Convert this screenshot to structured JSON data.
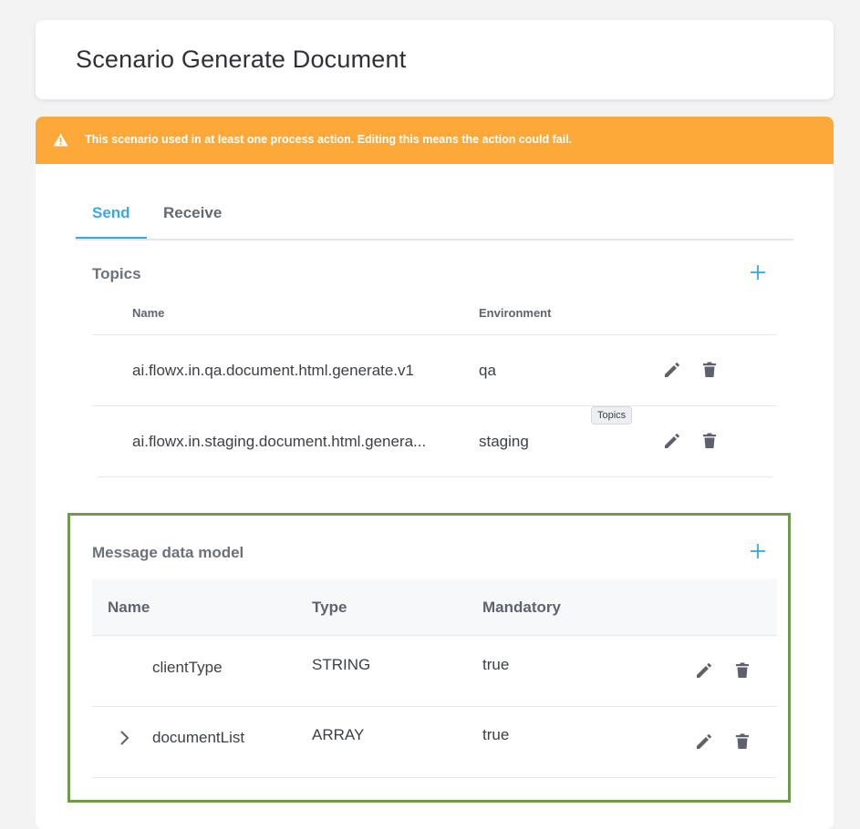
{
  "header": {
    "title": "Scenario Generate Document"
  },
  "warning": {
    "icon": "warning-icon",
    "text": "This scenario used in at least one process action. Editing this means the action could fail."
  },
  "tabs": [
    {
      "label": "Send",
      "active": true
    },
    {
      "label": "Receive",
      "active": false
    }
  ],
  "topics": {
    "title": "Topics",
    "add_icon": "plus-icon",
    "columns": {
      "name": "Name",
      "environment": "Environment"
    },
    "rows": [
      {
        "name": "ai.flowx.in.qa.document.html.generate.v1",
        "environment": "qa"
      },
      {
        "name": "ai.flowx.in.staging.document.html.genera...",
        "environment": "staging"
      }
    ],
    "tooltip": "Topics"
  },
  "message_model": {
    "title": "Message data model",
    "add_icon": "plus-icon",
    "columns": {
      "name": "Name",
      "type": "Type",
      "mandatory": "Mandatory"
    },
    "rows": [
      {
        "name": "clientType",
        "type": "STRING",
        "mandatory": "true",
        "expandable": false
      },
      {
        "name": "documentList",
        "type": "ARRAY",
        "mandatory": "true",
        "expandable": true
      }
    ]
  },
  "colors": {
    "accent": "#37a9e3",
    "warning": "#fca93a",
    "highlight_border": "#6f9a4a"
  }
}
